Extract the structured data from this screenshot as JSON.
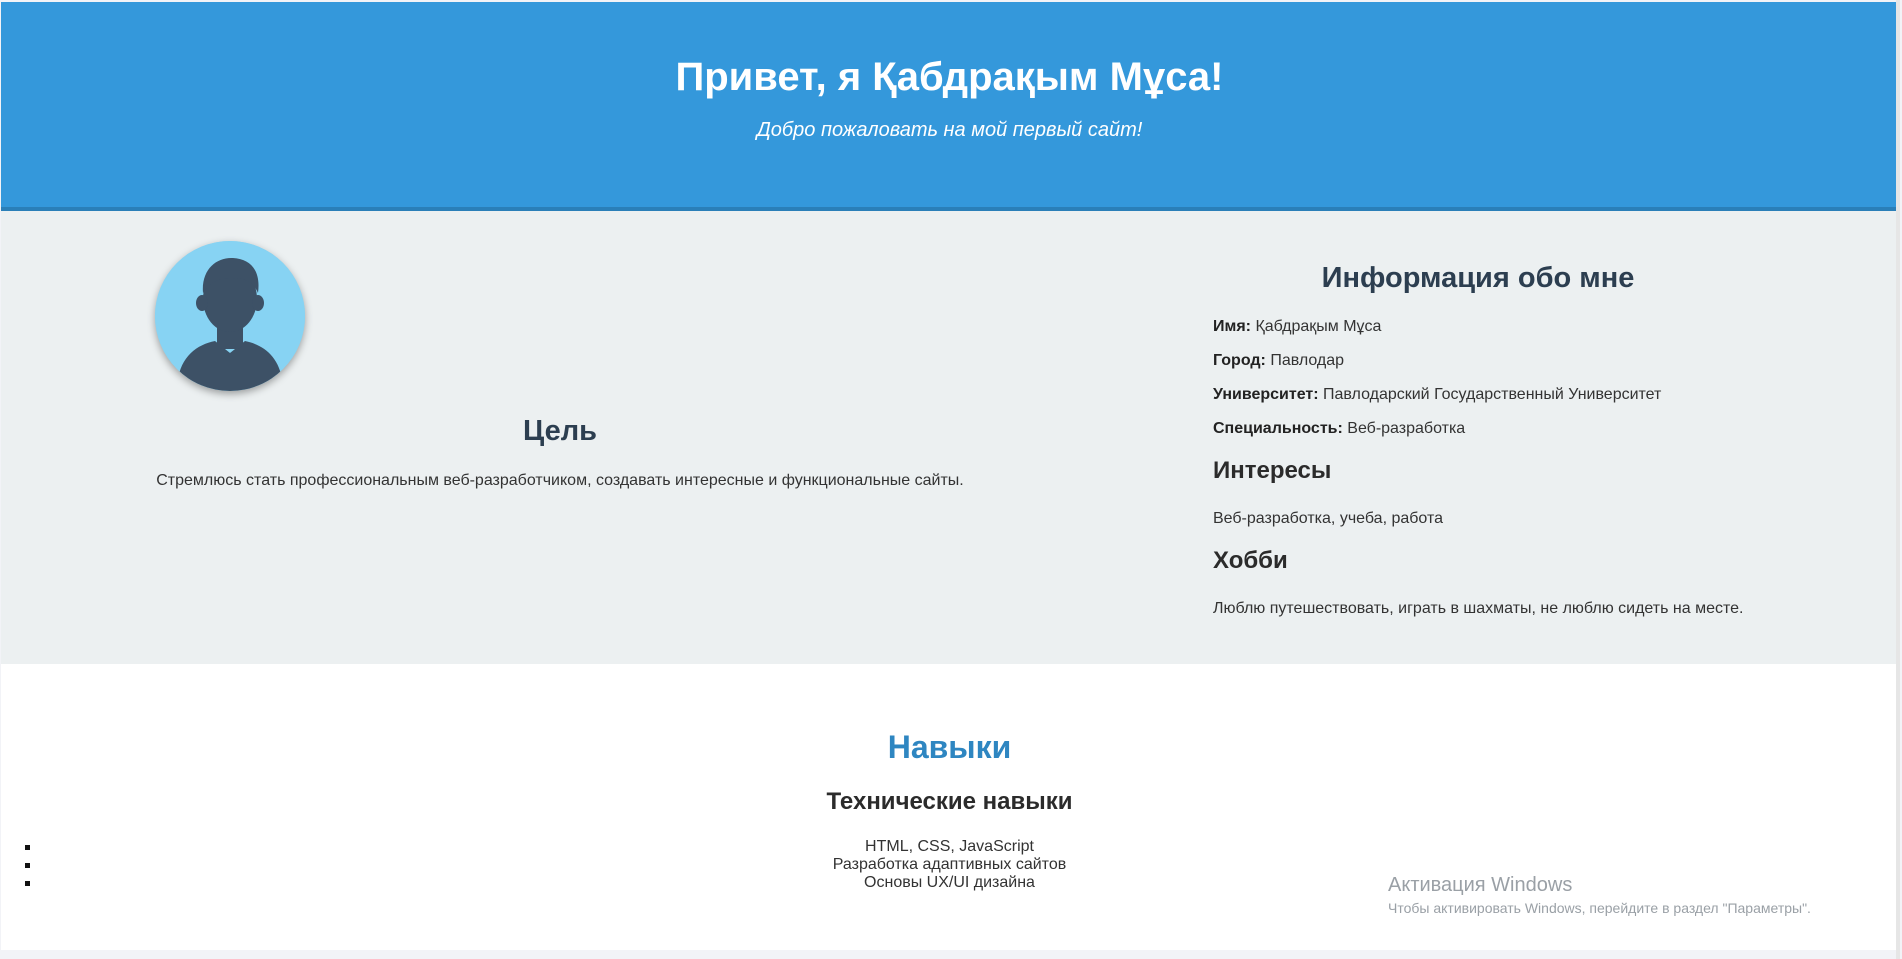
{
  "header": {
    "title": "Привет, я Қабдрақым Мұса!",
    "subtitle": "Добро пожаловать на мой первый сайт!"
  },
  "about": {
    "avatar_icon": "user-silhouette-icon",
    "goal": {
      "title": "Цель",
      "text": "Стремлюсь стать профессиональным веб-разработчиком, создавать интересные и функциональные сайты."
    },
    "info": {
      "title": "Информация обо мне",
      "rows": [
        {
          "label": "Имя:",
          "value": "Қабдрақым Мұса"
        },
        {
          "label": "Город:",
          "value": "Павлодар"
        },
        {
          "label": "Университет:",
          "value": "Павлодарский Государственный Университет"
        },
        {
          "label": "Специальность:",
          "value": "Веб-разработка"
        }
      ],
      "interests": {
        "title": "Интересы",
        "text": "Веб-разработка, учеба, работа"
      },
      "hobby": {
        "title": "Хобби",
        "text": "Люблю путешествовать, играть в шахматы, не люблю сидеть на месте."
      }
    }
  },
  "skills": {
    "title": "Навыки",
    "subtitle": "Технические навыки",
    "items": [
      "HTML, CSS, JavaScript",
      "Разработка адаптивных сайтов",
      "Основы UX/UI дизайна"
    ]
  },
  "watermark": {
    "title": "Активация Windows",
    "text": "Чтобы активировать Windows, перейдите в раздел \"Параметры\"."
  },
  "colors": {
    "header_bg": "#3498db",
    "about_bg": "#ecf0f1",
    "skills_title": "#2e86c1",
    "avatar_bg": "#87d3f3",
    "avatar_figure": "#3d5166"
  }
}
